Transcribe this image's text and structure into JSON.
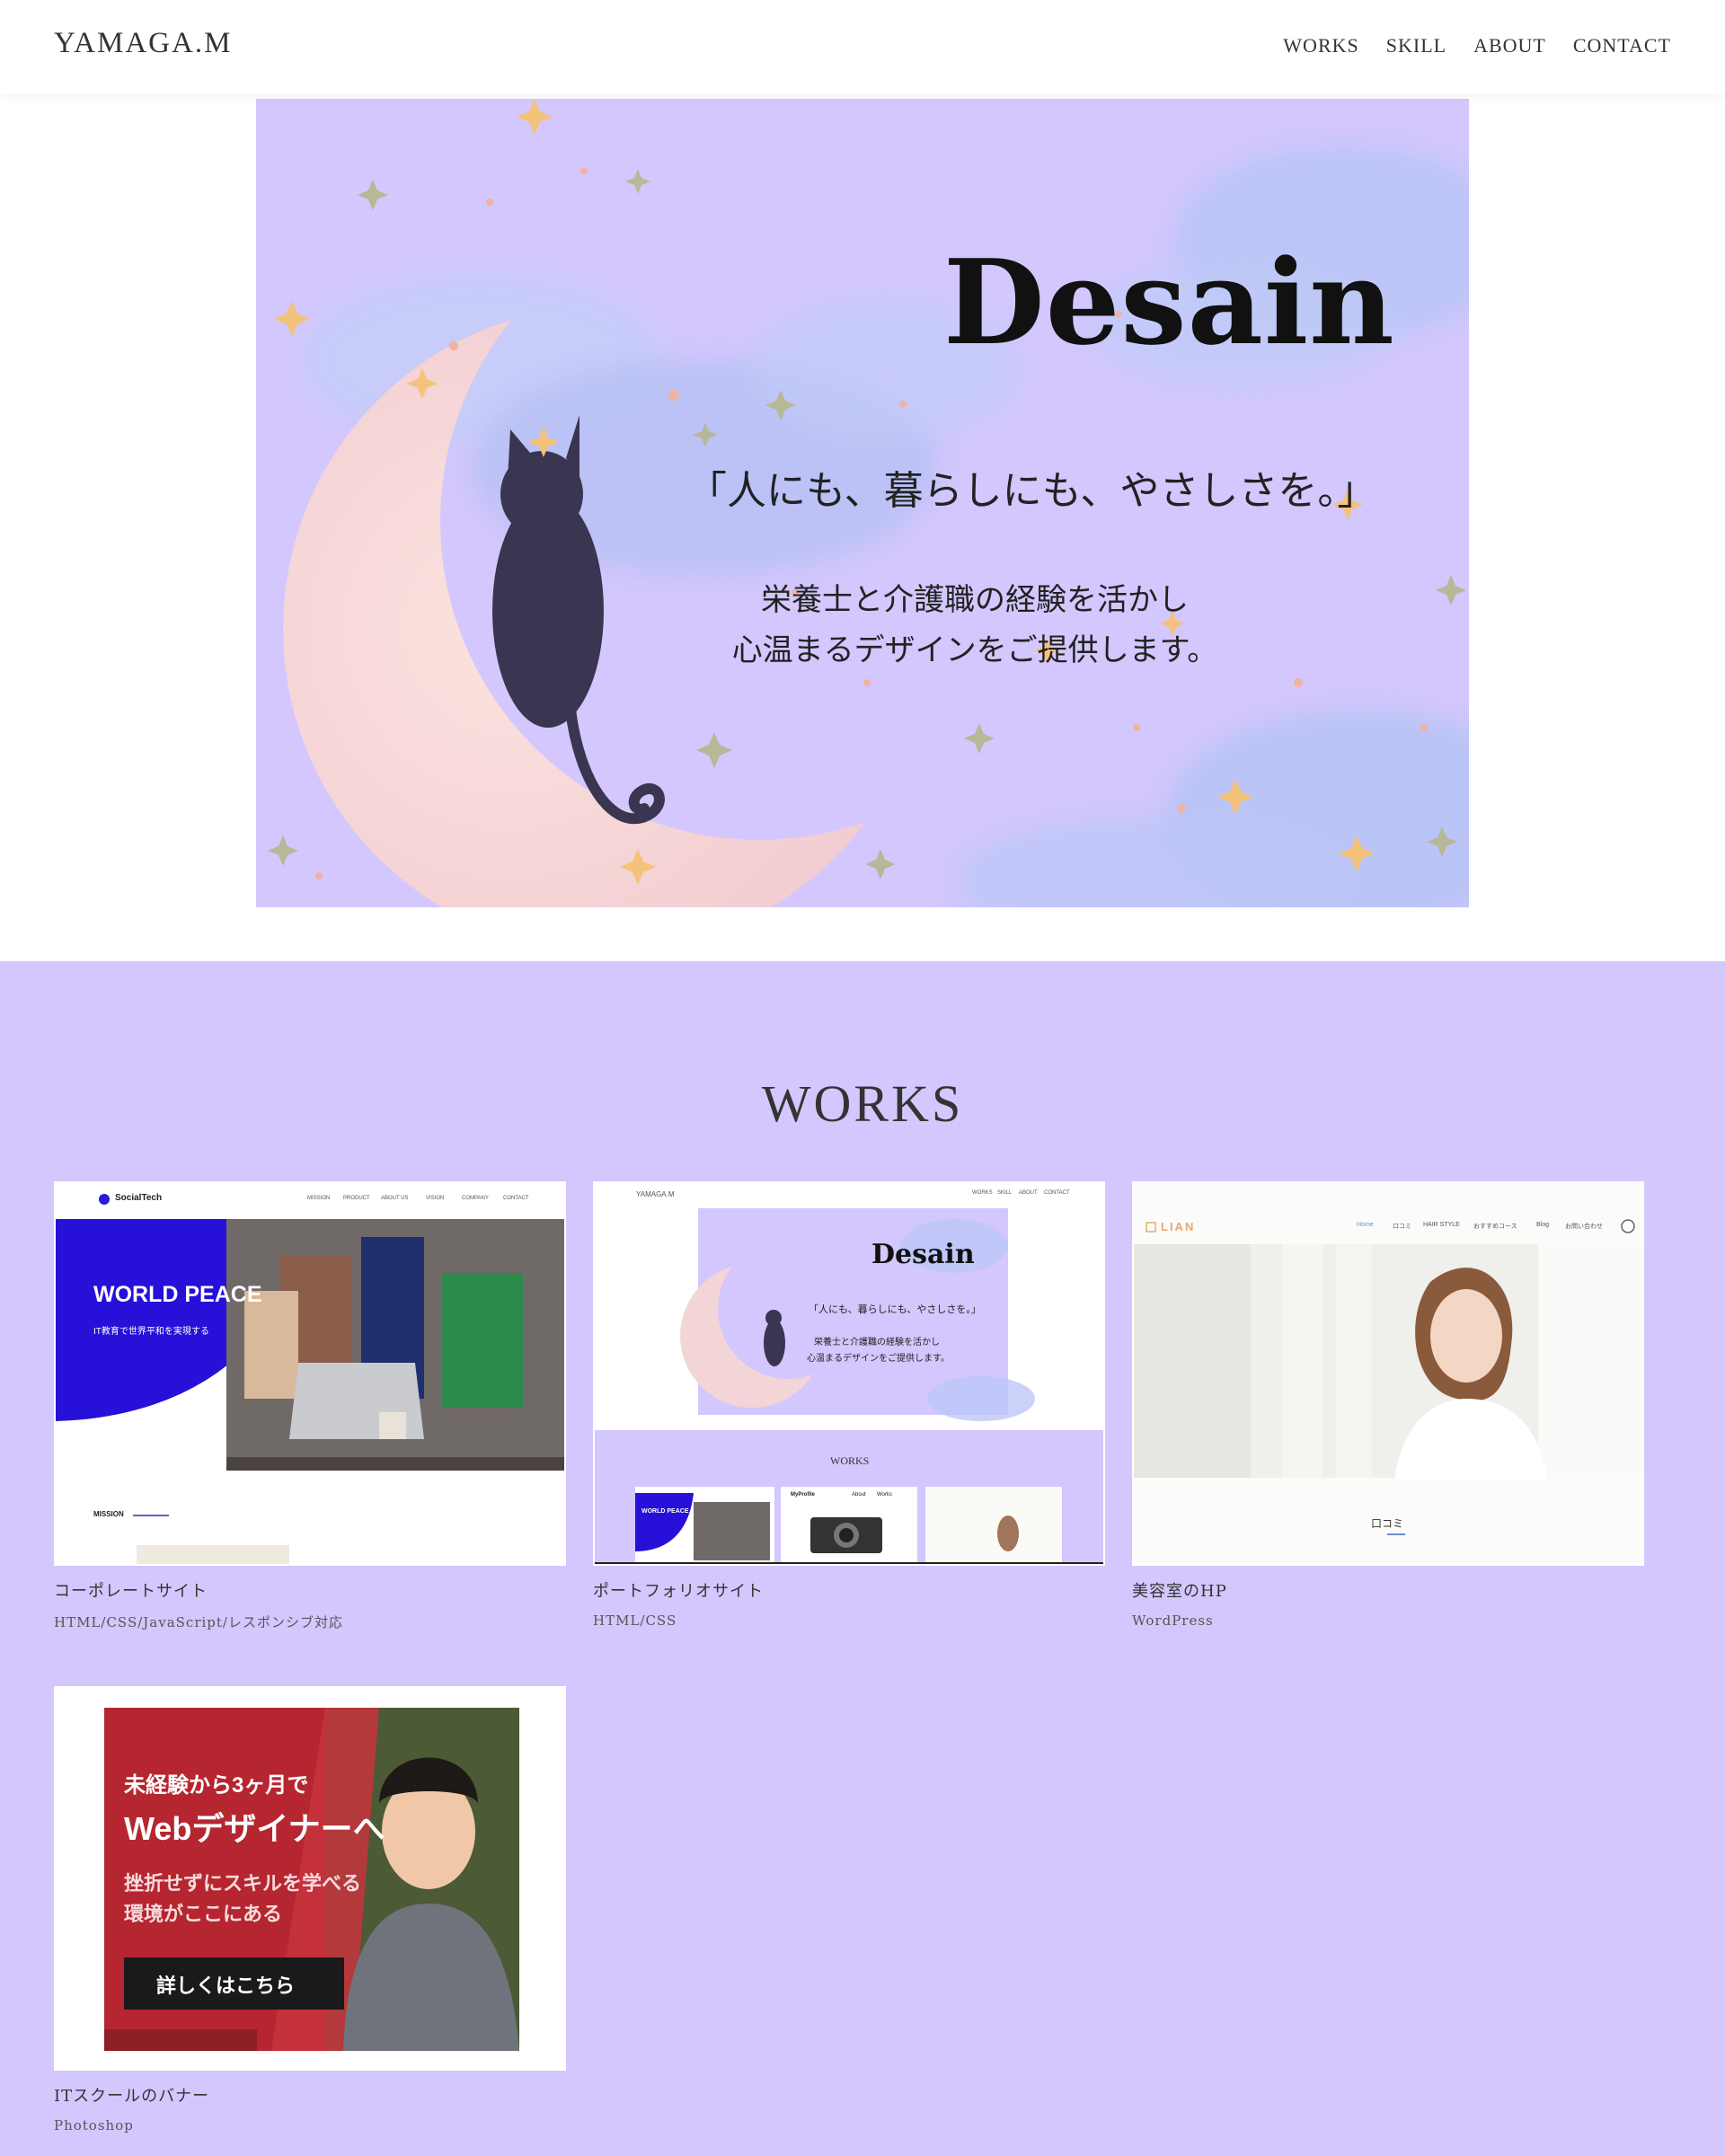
{
  "header": {
    "logo": "YAMAGA.M",
    "nav": [
      "WORKS",
      "SKILL",
      "ABOUT",
      "CONTACT"
    ]
  },
  "hero": {
    "title": "Desain",
    "tagline": "「人にも、暮らしにも、やさしさを。」",
    "description": [
      "栄養士と介護職の経験を活かし",
      "心温まるデザインをご提供します。"
    ],
    "colors": {
      "background": "#d3c7fd",
      "moon": "#f6d3d3",
      "cat": "#3a3550"
    }
  },
  "works": {
    "heading": "WORKS",
    "items": [
      {
        "title": "コーポレートサイト",
        "tags": "HTML/CSS/JavaScript/レスポンシブ対応",
        "thumb": {
          "brand": "SocialTech",
          "nav": [
            "MISSION",
            "PRODUCT",
            "ABOUT US",
            "VISION",
            "COMPANY",
            "CONTACT"
          ],
          "headline": "WORLD PEACE",
          "sub": "IT教育で世界平和を実現する",
          "section": "MISSION"
        }
      },
      {
        "title": "ポートフォリオサイト",
        "tags": "HTML/CSS",
        "thumb": {
          "logo": "YAMAGA.M",
          "nav": [
            "WORKS",
            "SKILL",
            "ABOUT",
            "CONTACT"
          ],
          "title": "Desain",
          "tagline": "「人にも、暮らしにも、やさしさを。」",
          "desc": [
            "栄養士と介護職の経験を活かし",
            "心温まるデザインをご提供します。"
          ],
          "works": "WORKS",
          "mini_headline": "WORLD PEACE",
          "mini_profile": "MyProfile",
          "mini_about": "About",
          "mini_works": "Works"
        }
      },
      {
        "title": "美容室のHP",
        "tags": "WordPress",
        "thumb": {
          "logo": "LIAN",
          "nav": [
            "Home",
            "口コミ",
            "HAIR STYLE",
            "おすすめコース",
            "Blog",
            "お問い合わせ"
          ],
          "section": "口コミ"
        }
      },
      {
        "title": "ITスクールのバナー",
        "tags": "Photoshop",
        "thumb": {
          "line1": "未経験から3ヶ月で",
          "line2": "Webデザイナーへ",
          "line3": "挫折せずにスキルを学べる",
          "line4": "環境がここにある",
          "button": "詳しくはこちら"
        }
      }
    ]
  }
}
